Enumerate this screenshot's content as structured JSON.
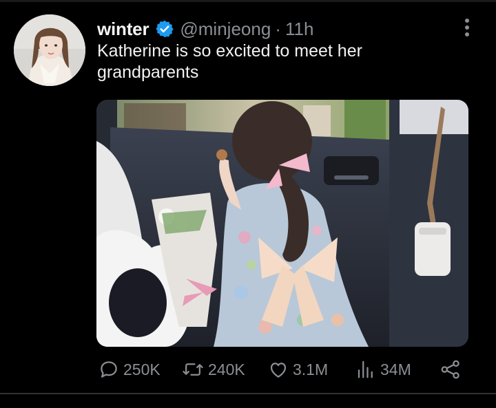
{
  "tweet": {
    "display_name": "winter",
    "handle": "@minjeong",
    "separator": "·",
    "time": "11h",
    "text": "Katherine is so excited to meet her grandparents",
    "verified": true,
    "avatar_icon": "profile-photo",
    "media_icon": "photo-girl-in-car"
  },
  "actions": {
    "reply": {
      "icon": "comment-icon",
      "count": "250K"
    },
    "retweet": {
      "icon": "retweet-icon",
      "count": "240K"
    },
    "like": {
      "icon": "heart-icon",
      "count": "3.1M"
    },
    "views": {
      "icon": "bar-chart-icon",
      "count": "34M"
    },
    "share": {
      "icon": "share-icon"
    }
  },
  "colors": {
    "background": "#000000",
    "text": "#e7e9ea",
    "muted": "#8b8f94",
    "verified": "#1d9bf0"
  }
}
